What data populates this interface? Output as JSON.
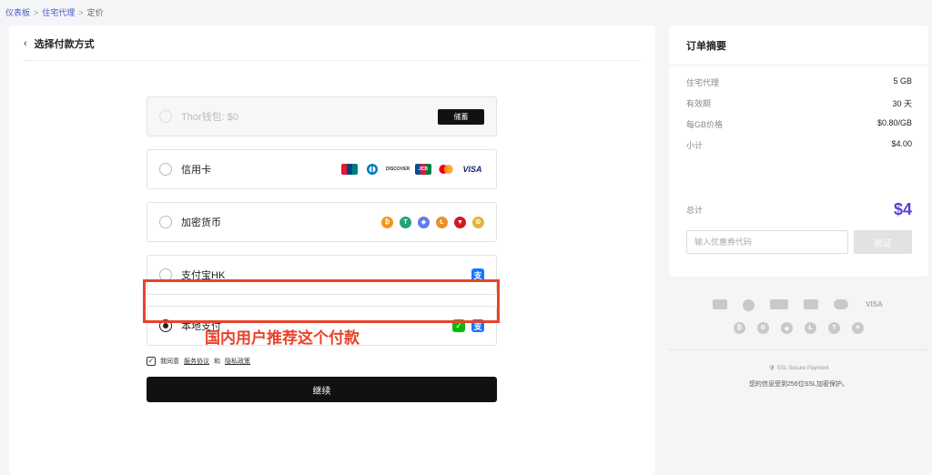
{
  "breadcrumb": {
    "items": [
      "仪表板",
      "住宅代理",
      "定价"
    ],
    "sep": ">"
  },
  "main": {
    "back_icon": "chevron-left-icon",
    "title": "选择付款方式",
    "options": [
      {
        "label": "Thor钱包: $0",
        "action": "储蓄",
        "disabled": true
      },
      {
        "label": "信用卡",
        "icons": [
          "union-pay",
          "diners-club",
          "discover",
          "jcb",
          "mastercard",
          "visa"
        ],
        "visa_text": "VISA",
        "discover_text": "DISCOVER",
        "jcb_text": "JCB"
      },
      {
        "label": "加密货币",
        "icons": [
          "bitcoin",
          "tether",
          "ethereum",
          "litecoin",
          "tron",
          "dogecoin"
        ]
      },
      {
        "label": "支付宝HK",
        "icons": [
          "alipay"
        ]
      },
      {
        "label": "本地支付",
        "icons": [
          "wechat-pay",
          "alipay"
        ],
        "selected": true
      }
    ],
    "annotation": "国内用户推荐这个付款",
    "agree": {
      "prefix": "我同意",
      "terms": "服务协议",
      "and": "和",
      "privacy": "隐私政策"
    },
    "continue_label": "继续"
  },
  "summary": {
    "title": "订单摘要",
    "rows": [
      {
        "k": "住宅代理",
        "v": "5 GB"
      },
      {
        "k": "有效期",
        "v": "30 天"
      },
      {
        "k": "每GB价格",
        "v": "$0.80/GB"
      },
      {
        "k": "小计",
        "v": "$4.00"
      }
    ],
    "total_label": "总计",
    "total_value": "$4",
    "coupon_placeholder": "输入优惠券代码",
    "verify_label": "验证"
  },
  "accepted": {
    "visa_text": "VISA",
    "ssl_label": "SSL Secure Payment",
    "ssl_desc": "您的信息受到256位SSL加密保护。"
  },
  "colors": {
    "accent": "#5b3fd6",
    "annotation": "#e8432a",
    "primary_button": "#111111"
  }
}
